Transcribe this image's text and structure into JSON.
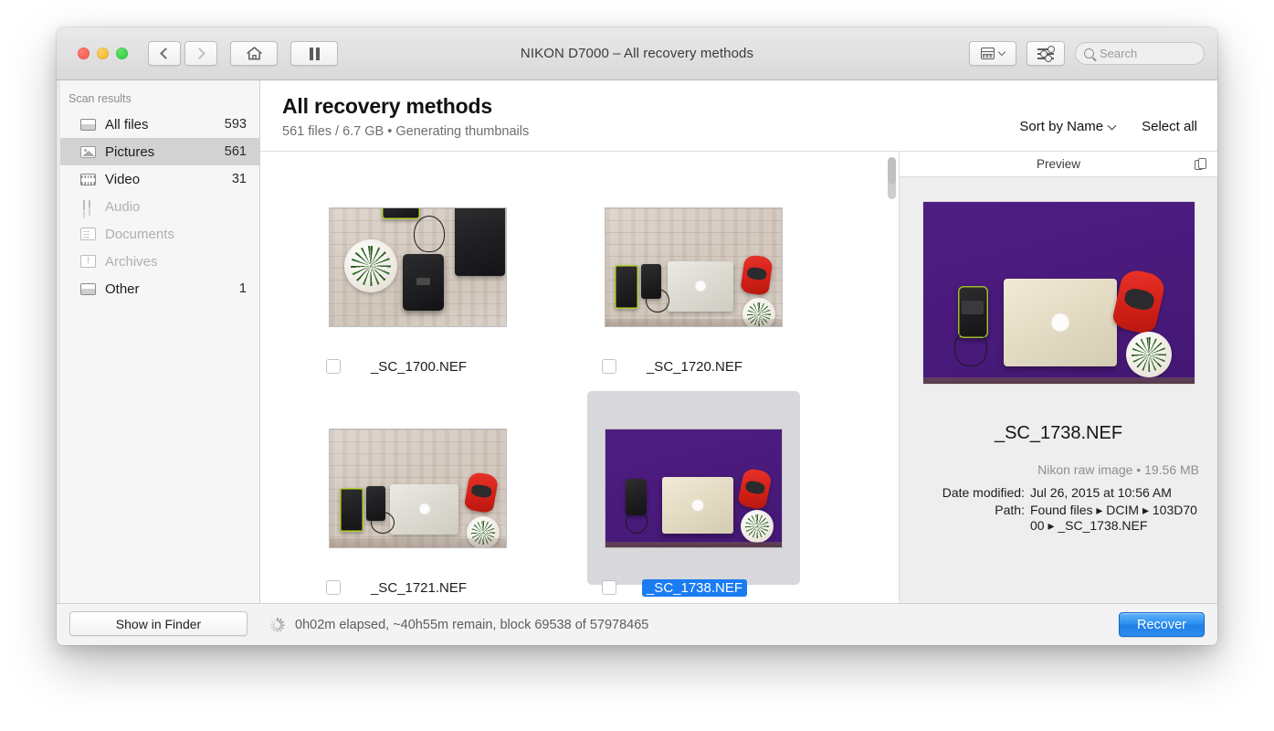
{
  "window": {
    "title": "NIKON D7000 – All recovery methods",
    "traffic_lights": [
      "close",
      "minimize",
      "zoom"
    ],
    "toolbar": {
      "back_icon": "chevron-left-icon",
      "forward_icon": "chevron-right-icon",
      "home_icon": "home-icon",
      "pause_icon": "pause-icon",
      "view_icon": "grid-view-icon",
      "view_chevron_icon": "chevron-down-icon",
      "filter_icon": "sliders-icon",
      "search_icon": "search-icon",
      "search_placeholder": "Search",
      "search_value": ""
    }
  },
  "sidebar": {
    "header": "Scan results",
    "items": [
      {
        "label": "All files",
        "count": "593",
        "icon": "files-icon",
        "selected": false,
        "disabled": false
      },
      {
        "label": "Pictures",
        "count": "561",
        "icon": "picture-icon",
        "selected": true,
        "disabled": false
      },
      {
        "label": "Video",
        "count": "31",
        "icon": "film-icon",
        "selected": false,
        "disabled": false
      },
      {
        "label": "Audio",
        "count": "",
        "icon": "music-note-icon",
        "selected": false,
        "disabled": true
      },
      {
        "label": "Documents",
        "count": "",
        "icon": "document-icon",
        "selected": false,
        "disabled": true
      },
      {
        "label": "Archives",
        "count": "",
        "icon": "archive-icon",
        "selected": false,
        "disabled": true
      },
      {
        "label": "Other",
        "count": "1",
        "icon": "files-icon",
        "selected": false,
        "disabled": false
      }
    ],
    "show_in_finder_label": "Show in Finder"
  },
  "main": {
    "title": "All recovery methods",
    "subtitle": "561 files / 6.7 GB • Generating thumbnails",
    "sort_label": "Sort by Name",
    "sort_chevron_icon": "chevron-down-icon",
    "select_all_label": "Select all",
    "files": [
      {
        "name": "_SC_1700.NEF",
        "scene": "wood-hdd",
        "selected": false,
        "checked": false
      },
      {
        "name": "_SC_1720.NEF",
        "scene": "wood-laptop",
        "selected": false,
        "checked": false
      },
      {
        "name": "_SC_1721.NEF",
        "scene": "wood-laptop",
        "selected": false,
        "checked": false
      },
      {
        "name": "_SC_1738.NEF",
        "scene": "purple-laptop",
        "selected": true,
        "checked": false
      }
    ]
  },
  "preview": {
    "header_title": "Preview",
    "copy_icon": "duplicate-panes-icon",
    "image_scene": "purple-laptop",
    "filename": "_SC_1738.NEF",
    "kind_and_size": "Nikon raw image • 19.56 MB",
    "date_modified_label": "Date modified:",
    "date_modified_value": "Jul 26, 2015 at 10:56 AM",
    "path_label": "Path:",
    "path_value_line1": "Found files ▸ DCIM ▸ 103D70",
    "path_value_line2": "00 ▸ _SC_1738.NEF"
  },
  "status": {
    "spinner_icon": "progress-spinner-icon",
    "text": "0h02m elapsed, ~40h55m remain, block 69538 of 57978465",
    "recover_label": "Recover"
  },
  "colors": {
    "accent_blue": "#1a7cf0",
    "recover_blue": "#2a8ef0",
    "sidebar_selected": "#d2d2d2",
    "thumb_selected_bg": "#d8d8dc",
    "purple_backdrop": "#4a1b7c"
  }
}
